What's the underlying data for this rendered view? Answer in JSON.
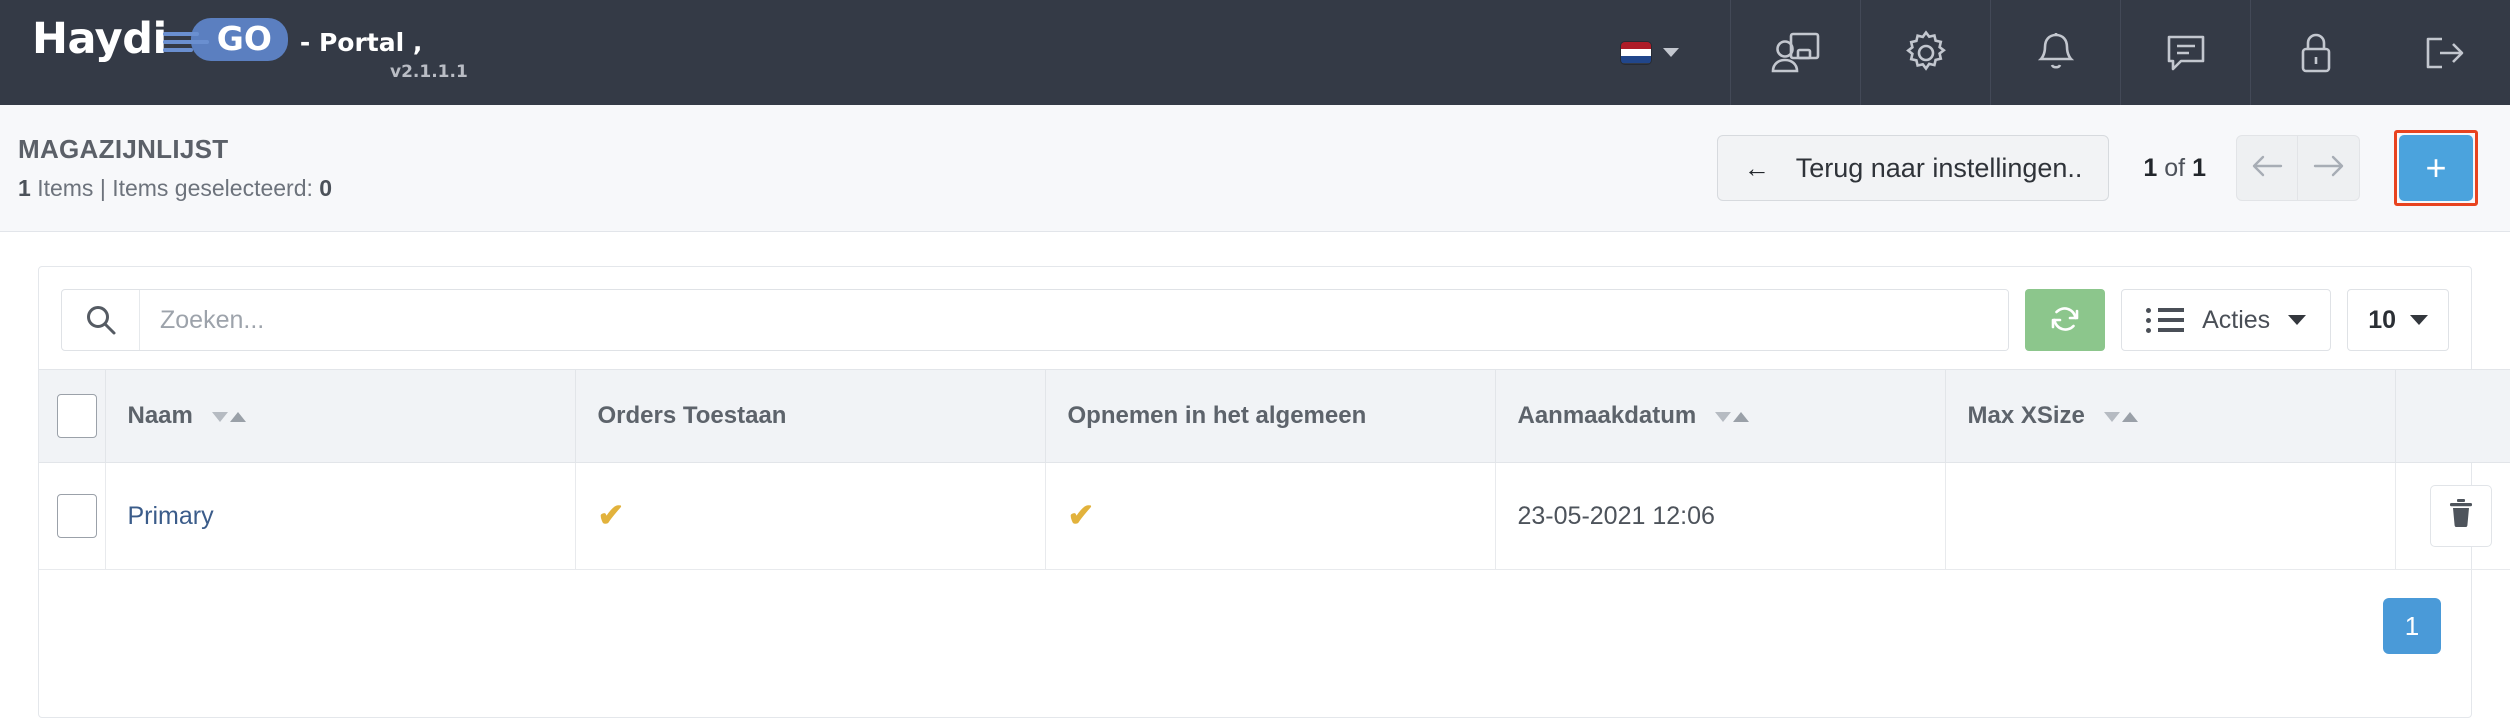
{
  "navbar": {
    "brand_name": "Haydi",
    "brand_badge": "GO",
    "brand_suffix": "- Portal ,",
    "version": "v2.1.1.1",
    "language_flag": "netherlands-flag",
    "icons": [
      {
        "name": "user-presentation-icon",
        "label": "Gebruiker"
      },
      {
        "name": "gear-icon",
        "label": "Instellingen"
      },
      {
        "name": "bell-icon",
        "label": "Meldingen"
      },
      {
        "name": "chat-icon",
        "label": "Berichten"
      },
      {
        "name": "lock-icon",
        "label": "Vergrendelen"
      },
      {
        "name": "logout-icon",
        "label": "Uitloggen"
      }
    ]
  },
  "titlebar": {
    "title": "MAGAZIJNLIJST",
    "items_count": "1",
    "items_word": "Items",
    "separator": "|",
    "selected_label": "Items geselecteerd:",
    "selected_count": "0",
    "back_button": "Terug naar instellingen..",
    "back_arrow": "←",
    "pager_current": "1",
    "pager_of": "of",
    "pager_total": "1",
    "prev_icon": "arrow-left-icon",
    "next_icon": "arrow-right-icon",
    "add_label": "+",
    "add_highlight_color": "#e8431f",
    "add_button_color": "#4ba3dd"
  },
  "toolbar": {
    "search_placeholder": "Zoeken...",
    "search_value": "",
    "refresh_icon": "refresh-icon",
    "refresh_color": "#8cc68c",
    "actions_label": "Acties",
    "page_size": "10"
  },
  "table": {
    "columns": [
      {
        "key": "check",
        "label": "",
        "sortable": false
      },
      {
        "key": "naam",
        "label": "Naam",
        "sortable": true
      },
      {
        "key": "orders",
        "label": "Orders Toestaan",
        "sortable": false
      },
      {
        "key": "opnemen",
        "label": "Opnemen in het algemeen",
        "sortable": false
      },
      {
        "key": "datum",
        "label": "Aanmaakdatum",
        "sortable": true
      },
      {
        "key": "xsize",
        "label": "Max XSize",
        "sortable": true
      },
      {
        "key": "actions",
        "label": "",
        "sortable": false
      }
    ],
    "rows": [
      {
        "naam": "Primary",
        "orders": "✔",
        "opnemen": "✔",
        "datum": "23-05-2021 12:06",
        "xsize": "",
        "delete_icon": "trash-icon"
      }
    ],
    "check_color": "#e2b23c"
  },
  "pagination": {
    "pages": [
      "1"
    ],
    "active": "1",
    "active_color": "#4a9ad8"
  }
}
